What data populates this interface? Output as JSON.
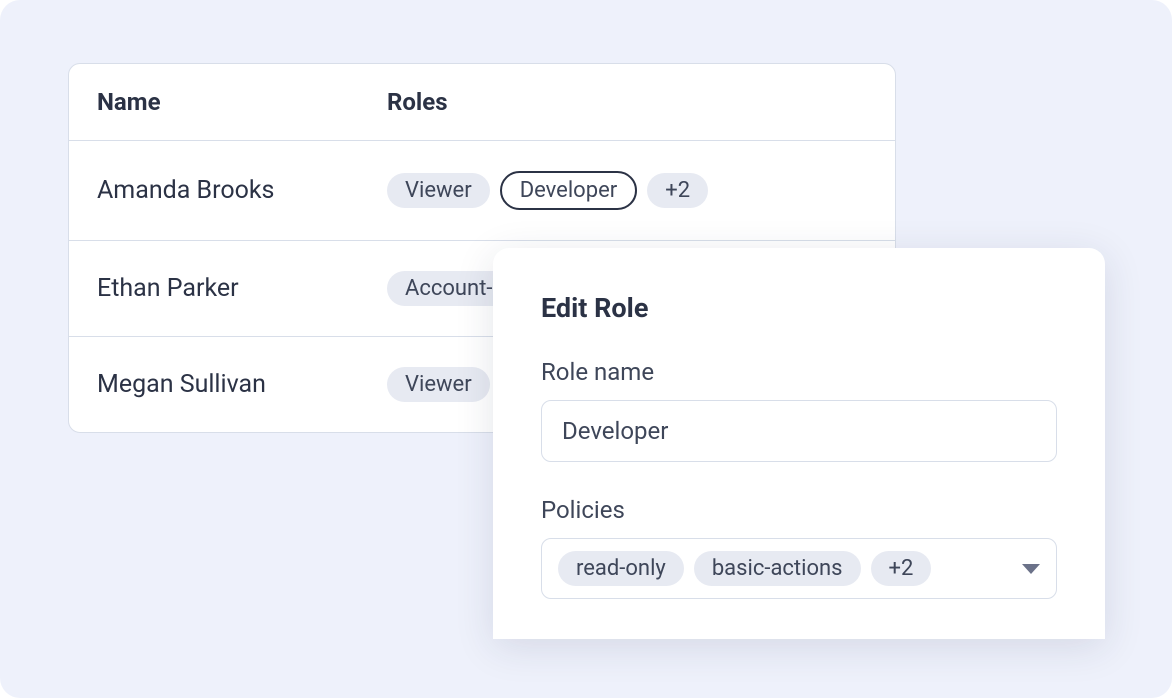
{
  "table": {
    "headers": {
      "name": "Name",
      "roles": "Roles"
    },
    "rows": [
      {
        "name": "Amanda Brooks",
        "roles": [
          "Viewer",
          "Developer"
        ],
        "overflow": "+2"
      },
      {
        "name": "Ethan Parker",
        "roles": [
          "Account-"
        ],
        "overflow": null
      },
      {
        "name": "Megan Sullivan",
        "roles": [
          "Viewer"
        ],
        "overflow": null
      }
    ]
  },
  "popover": {
    "title": "Edit Role",
    "role_name_label": "Role name",
    "role_name_value": "Developer",
    "policies_label": "Policies",
    "policies": [
      "read-only",
      "basic-actions"
    ],
    "policies_overflow": "+2"
  }
}
